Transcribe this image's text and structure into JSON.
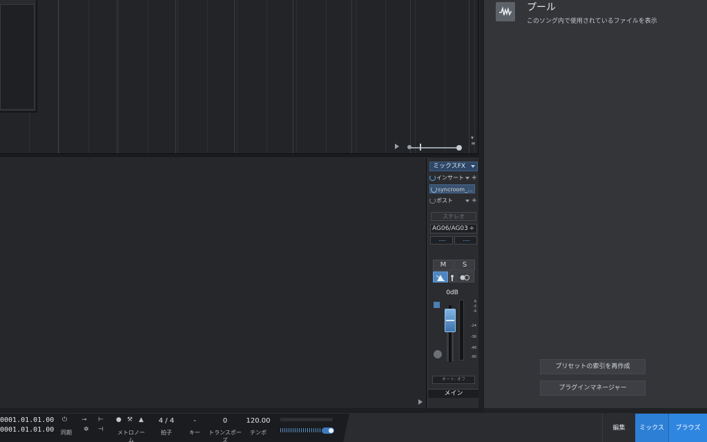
{
  "browser": {
    "pool_title": "プール",
    "pool_desc": "このソング内で使用されているファイルを表示",
    "rebuild_presets_label": "プリセットの索引を再作成",
    "plugin_manager_label": "プラグインマネージャー"
  },
  "strip": {
    "mixfx_label": "ミックスFX",
    "insert_label": "インサート",
    "insert_slot_label": "syncroom_...",
    "post_label": "ポスト",
    "stereo_label": "ステレオ",
    "io_label": "AG06/AG03",
    "mute_label": "M",
    "solo_label": "S",
    "level_label": "0dB",
    "meter_scale": [
      "6",
      "-3",
      "-9",
      "-24",
      "-36",
      "-48",
      "-90"
    ],
    "automation_label": "オート: オフ",
    "channel_name": "メイン"
  },
  "transport": {
    "time_top": "0001.01.01.00",
    "time_bottom": "0001.01.01.00",
    "sync_label": "同期",
    "metronome_label": "メトロノーム",
    "time_sig_value": "4 / 4",
    "time_sig_label": "拍子",
    "key_value": "-",
    "key_label": "キー",
    "transpose_value": "0",
    "transpose_label": "トランスポーズ",
    "tempo_value": "120.00",
    "tempo_label": "テンポ"
  },
  "tabs": {
    "edit": "編集",
    "mix": "ミックス",
    "browse": "ブラウズ"
  },
  "colors": {
    "accent": "#2d7fd6",
    "fader": "#7fb4e6"
  }
}
